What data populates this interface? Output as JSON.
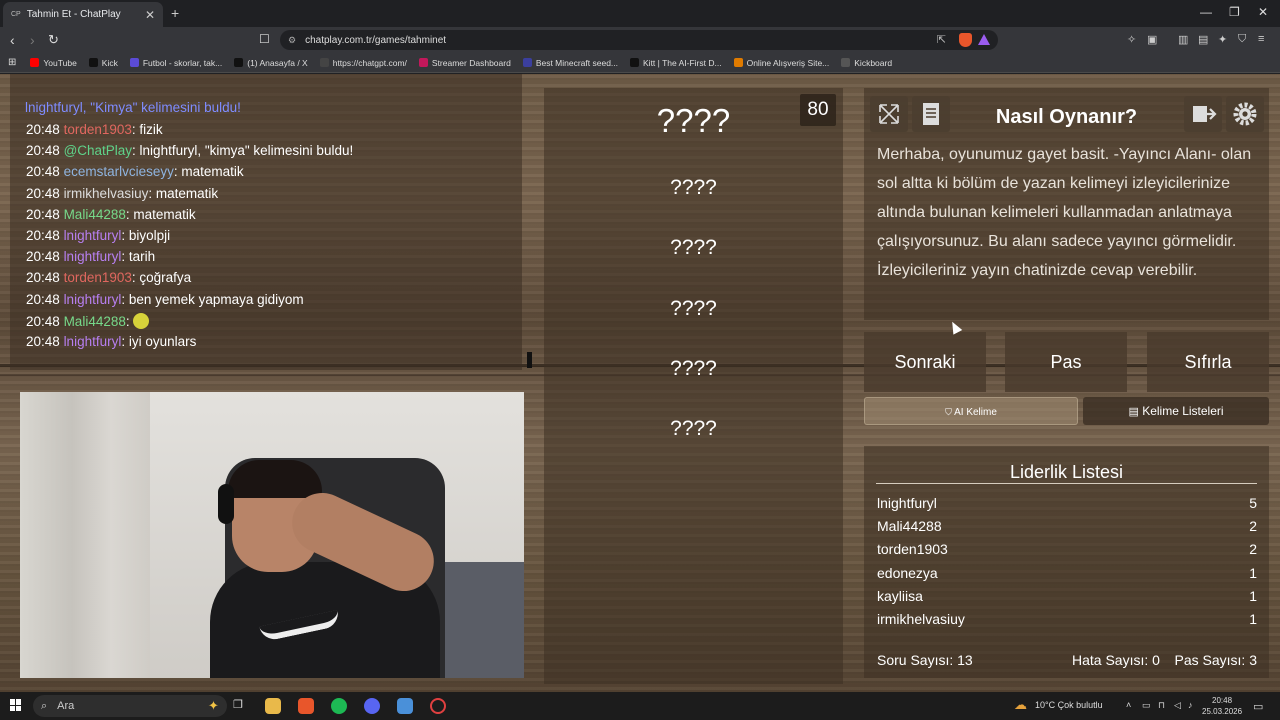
{
  "browser": {
    "tab_title": "Tahmin Et - ChatPlay",
    "tab_favicon": "CP",
    "url": "chatplay.com.tr/games/tahminet",
    "bookmarks": [
      {
        "label": "YouTube",
        "icon": "youtube-icon",
        "color": "#ff0000"
      },
      {
        "label": "Kick",
        "icon": "kick-icon",
        "color": "#111111"
      },
      {
        "label": "Futbol - skorlar, tak...",
        "icon": "futbol-icon",
        "color": "#5b4bd6"
      },
      {
        "label": "(1) Anasayfa / X",
        "icon": "x-icon",
        "color": "#111111"
      },
      {
        "label": "https://chatgpt.com/",
        "icon": "chatgpt-icon",
        "color": "#444444"
      },
      {
        "label": "Streamer Dashboard",
        "icon": "streamer-icon",
        "color": "#c2185b"
      },
      {
        "label": "Best Minecraft seed...",
        "icon": "minecraft-icon",
        "color": "#3b3f9e"
      },
      {
        "label": "Kitt | The AI-First D...",
        "icon": "kitt-icon",
        "color": "#111111"
      },
      {
        "label": "Online Alışveriş Site...",
        "icon": "shop-icon",
        "color": "#e07b00"
      },
      {
        "label": "Kickboard",
        "icon": "kickboard-icon",
        "color": "#555555"
      }
    ]
  },
  "chat": {
    "first_line": "lnightfuryl, \"Kimya\" kelimesini buldu!",
    "messages": [
      {
        "time": "20:48",
        "user": "torden1903",
        "color": "#e0675f",
        "text": ": fizik"
      },
      {
        "time": "20:48",
        "user": "@ChatPlay",
        "color": "#5fd38a",
        "text": ": lnightfuryl, \"kimya\" kelimesini buldu!"
      },
      {
        "time": "20:48",
        "user": "ecemstarlvcieseyy",
        "color": "#8fb4e0",
        "text": ": matematik"
      },
      {
        "time": "20:48",
        "user": "irmikhelvasiuy",
        "color": "#dcdcdc",
        "text": ": matematik"
      },
      {
        "time": "20:48",
        "user": "Mali44288",
        "color": "#77d98a",
        "text": ": matematik"
      },
      {
        "time": "20:48",
        "user": "lnightfuryl",
        "color": "#b77ff0",
        "text": ": biyolpji"
      },
      {
        "time": "20:48",
        "user": "lnightfuryl",
        "color": "#b77ff0",
        "text": ": tarih"
      },
      {
        "time": "20:48",
        "user": "torden1903",
        "color": "#e0675f",
        "text": ": çoğrafya"
      },
      {
        "time": "20:48",
        "user": "lnightfuryl",
        "color": "#b77ff0",
        "text": ": ben yemek yapmaya gidiyom"
      },
      {
        "time": "20:48",
        "user": "Mali44288",
        "color": "#77d98a",
        "text": ": ",
        "emote": "smile-emote-icon"
      },
      {
        "time": "20:48",
        "user": "lnightfuryl",
        "color": "#b77ff0",
        "text": ": iyi oyunlars"
      }
    ]
  },
  "game": {
    "timer": "80",
    "words": [
      "????",
      "????",
      "????",
      "????",
      "????",
      "????"
    ]
  },
  "howto": {
    "title": "Nasıl Oynanır?",
    "text": "Merhaba, oyunumuz gayet basit. -Yayıncı Alanı- olan sol altta ki bölüm de yazan kelimeyi izleyicilerinize altında bulunan kelimeleri kullanmadan anlatmaya çalışıyorsunuz. Bu alanı sadece yayıncı görmelidir. İzleyicileriniz yayın chatinizde cevap verebilir."
  },
  "actions": {
    "next": "Sonraki",
    "pass": "Pas",
    "reset": "Sıfırla",
    "ai_word": "AI Kelime",
    "word_lists": "Kelime Listeleri"
  },
  "leaderboard": {
    "title": "Liderlik Listesi",
    "rows": [
      {
        "name": "lnightfuryl",
        "score": "5"
      },
      {
        "name": "Mali44288",
        "score": "2"
      },
      {
        "name": "torden1903",
        "score": "2"
      },
      {
        "name": "edonezya",
        "score": "1"
      },
      {
        "name": "kayliisa",
        "score": "1"
      },
      {
        "name": "irmikhelvasiuy",
        "score": "1"
      }
    ],
    "question_count": "Soru Sayısı: 13",
    "error_count": "Hata Sayısı: 0",
    "pass_count": "Pas Sayısı: 3"
  },
  "taskbar": {
    "search_placeholder": "Ara",
    "weather": "10°C  Çok bulutlu",
    "time": "20:48",
    "date": "25.03.2026"
  }
}
